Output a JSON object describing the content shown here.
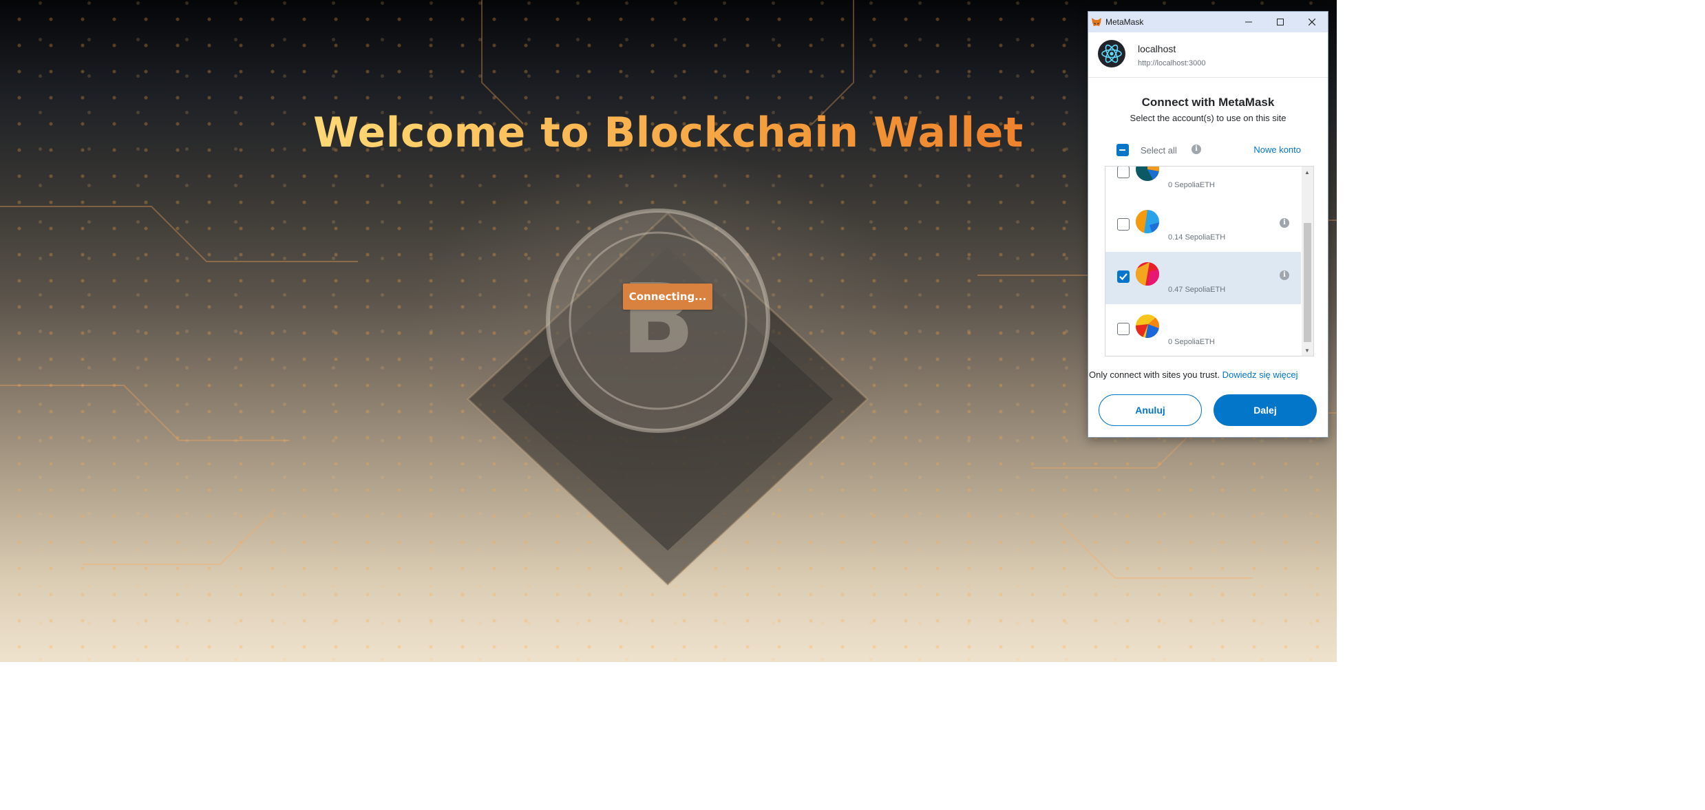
{
  "app": {
    "title": "Welcome to Blockchain Wallet",
    "connect_button": "Connecting..."
  },
  "metamask": {
    "window_title": "MetaMask",
    "site": {
      "name": "localhost",
      "url": "http://localhost:3000"
    },
    "heading": "Connect with MetaMask",
    "subheading": "Select the account(s) to use on this site",
    "select_all_label": "Select all",
    "new_account_link": "Nowe konto",
    "accounts": [
      {
        "balance": "0 SepoliaETH",
        "checked": false
      },
      {
        "balance": "0.14 SepoliaETH",
        "checked": false
      },
      {
        "balance": "0.47 SepoliaETH",
        "checked": true
      },
      {
        "balance": "0 SepoliaETH",
        "checked": false
      }
    ],
    "trust_text": "Only connect with sites you trust.",
    "learn_more": "Dowiedz się więcej",
    "cancel_button": "Anuluj",
    "next_button": "Dalej"
  }
}
